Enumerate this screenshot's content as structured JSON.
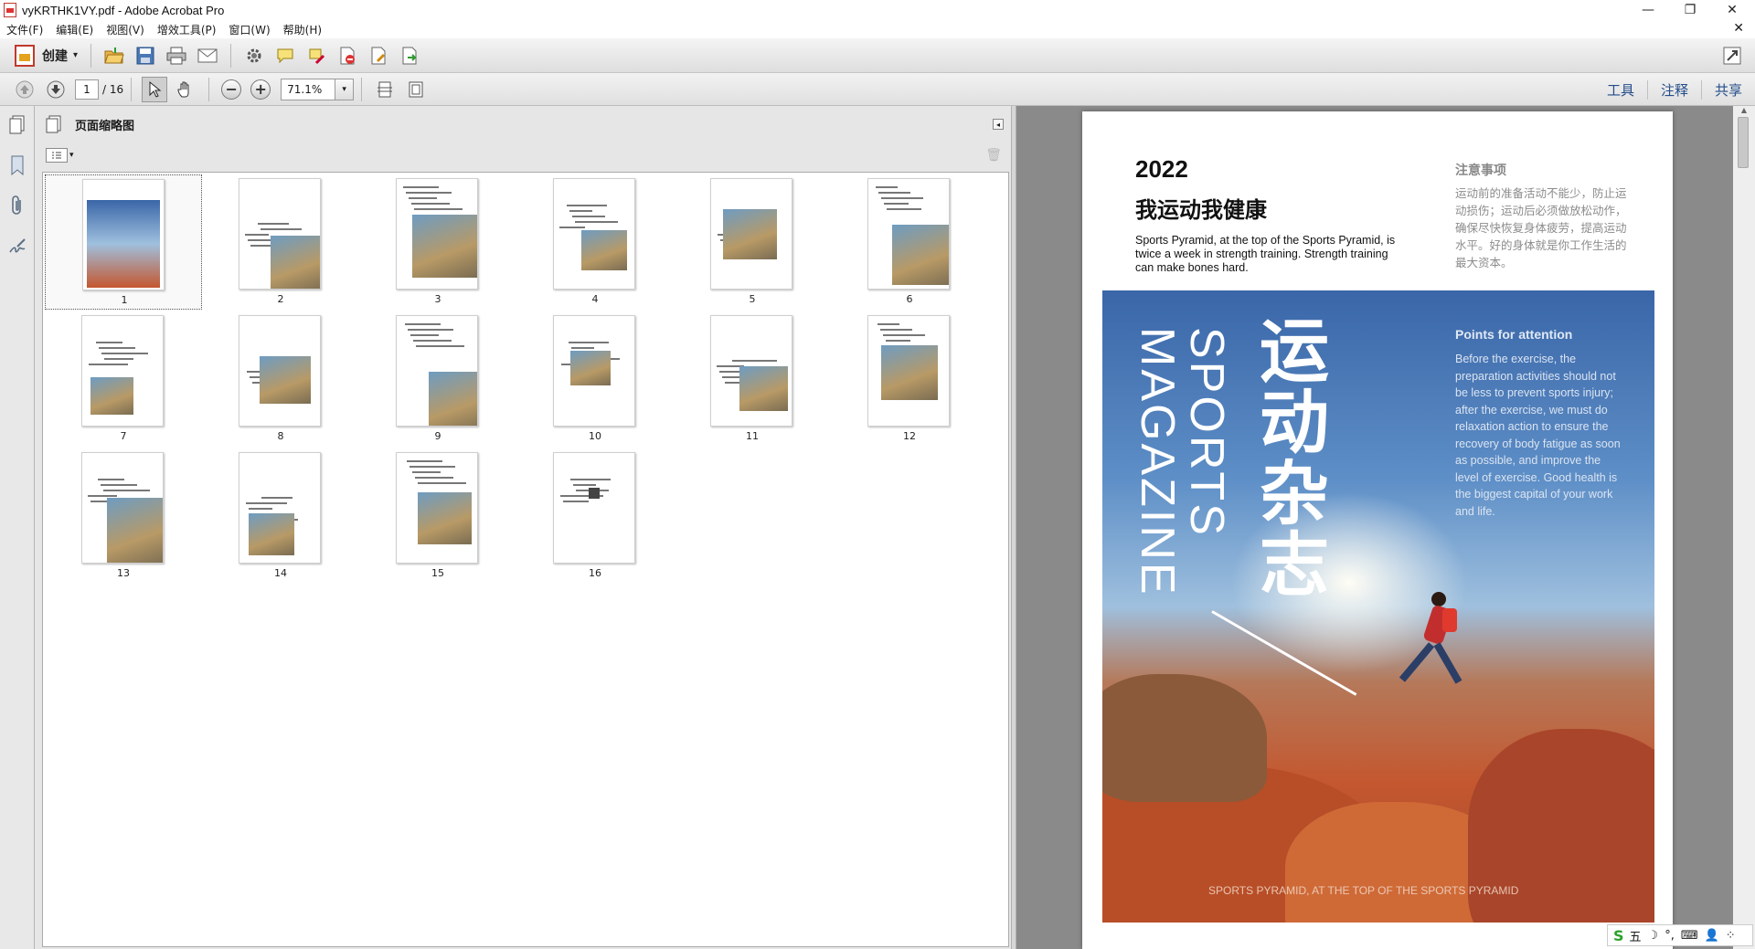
{
  "window": {
    "title": "vyKRTHK1VY.pdf - Adobe Acrobat Pro",
    "minimize": "—",
    "restore": "❐",
    "close": "✕"
  },
  "menu": {
    "items": [
      "文件(F)",
      "编辑(E)",
      "视图(V)",
      "增效工具(P)",
      "窗口(W)",
      "帮助(H)"
    ],
    "close": "✕"
  },
  "toolbar": {
    "create_label": "创建",
    "create_caret": "▾"
  },
  "nav": {
    "page_current": "1",
    "page_total": "/ 16",
    "zoom": "71.1%",
    "zoom_caret": "▾"
  },
  "right_links": [
    "工具",
    "注释",
    "共享"
  ],
  "panel": {
    "title": "页面缩略图",
    "options_caret": "▾",
    "collapse": "◂"
  },
  "thumbnails": [
    "1",
    "2",
    "3",
    "4",
    "5",
    "6",
    "7",
    "8",
    "9",
    "10",
    "11",
    "12",
    "13",
    "14",
    "15",
    "16"
  ],
  "document": {
    "year": "2022",
    "title": "我运动我健康",
    "desc": "Sports Pyramid, at the top of the Sports Pyramid, is twice a week in strength training. Strength training can make bones hard.",
    "note_title": "注意事项",
    "note_text": "运动前的准备活动不能少，防止运动损伤；运动后必须做放松动作，确保尽快恢复身体疲劳，提高运动水平。好的身体就是你工作生活的最大资本。",
    "hero": {
      "vertical_en1": "SPORTS",
      "vertical_en2": "MAGAZINE",
      "vertical_cn": "运动杂志",
      "pa_title": "Points for attention",
      "pa_text": "Before the exercise, the preparation activities should not be less to prevent sports injury; after the exercise, we must do relaxation action to ensure the recovery of body fatigue as soon as possible, and improve the level of exercise. Good health is the biggest capital of your work and life.",
      "footer": "SPORTS PYRAMID, AT THE TOP OF THE SPORTS PYRAMID"
    }
  },
  "ime": {
    "logo": "S",
    "items": [
      "五",
      "☽",
      "°,",
      "⌨",
      "👤",
      "⁘"
    ]
  }
}
